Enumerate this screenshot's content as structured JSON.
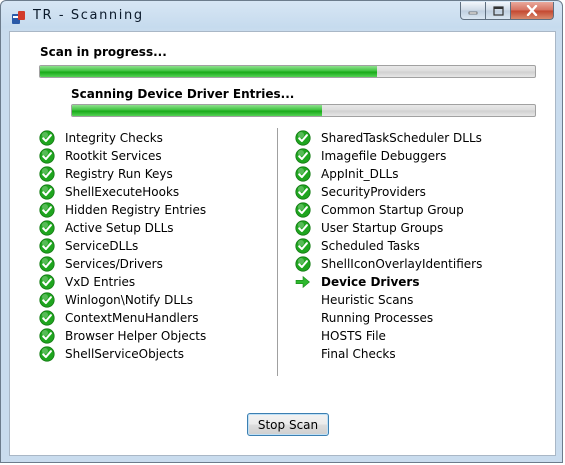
{
  "window": {
    "title": "TR - Scanning"
  },
  "scan": {
    "overall_label": "Scan in progress...",
    "overall_progress": 0.68,
    "sub_label": "Scanning Device Driver Entries...",
    "sub_progress": 0.54
  },
  "left_items": [
    {
      "label": "Integrity Checks",
      "status": "done"
    },
    {
      "label": "Rootkit Services",
      "status": "done"
    },
    {
      "label": "Registry Run Keys",
      "status": "done"
    },
    {
      "label": "ShellExecuteHooks",
      "status": "done"
    },
    {
      "label": "Hidden Registry Entries",
      "status": "done"
    },
    {
      "label": "Active Setup DLLs",
      "status": "done"
    },
    {
      "label": "ServiceDLLs",
      "status": "done"
    },
    {
      "label": "Services/Drivers",
      "status": "done"
    },
    {
      "label": "VxD Entries",
      "status": "done"
    },
    {
      "label": "Winlogon\\Notify DLLs",
      "status": "done"
    },
    {
      "label": "ContextMenuHandlers",
      "status": "done"
    },
    {
      "label": "Browser Helper Objects",
      "status": "done"
    },
    {
      "label": "ShellServiceObjects",
      "status": "done"
    }
  ],
  "right_items": [
    {
      "label": "SharedTaskScheduler DLLs",
      "status": "done"
    },
    {
      "label": "Imagefile Debuggers",
      "status": "done"
    },
    {
      "label": "AppInit_DLLs",
      "status": "done"
    },
    {
      "label": "SecurityProviders",
      "status": "done"
    },
    {
      "label": "Common Startup Group",
      "status": "done"
    },
    {
      "label": "User Startup Groups",
      "status": "done"
    },
    {
      "label": "Scheduled Tasks",
      "status": "done"
    },
    {
      "label": "ShellIconOverlayIdentifiers",
      "status": "done"
    },
    {
      "label": "Device Drivers",
      "status": "current"
    },
    {
      "label": "Heuristic Scans",
      "status": "pending"
    },
    {
      "label": "Running Processes",
      "status": "pending"
    },
    {
      "label": "HOSTS File",
      "status": "pending"
    },
    {
      "label": "Final Checks",
      "status": "pending"
    }
  ],
  "buttons": {
    "stop_label": "Stop Scan"
  },
  "icons": {
    "done": "green-check-icon",
    "current": "green-arrow-icon"
  },
  "colors": {
    "progress_fill": "#22b022",
    "check": "#1fa51f",
    "arrow": "#2db82d"
  }
}
